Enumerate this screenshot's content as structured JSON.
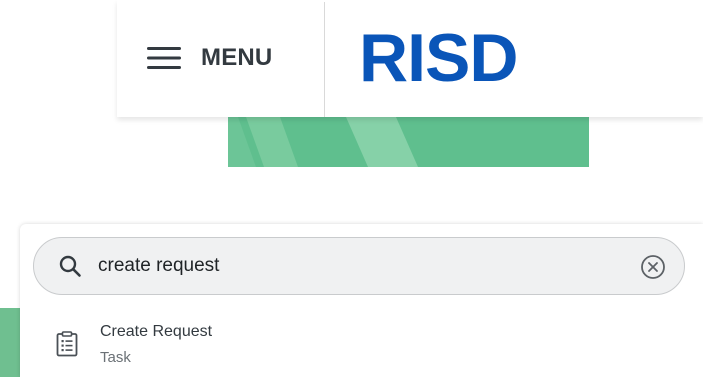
{
  "header": {
    "menu_label": "MENU",
    "logo_text": "RISD",
    "logo_color": "#0a55b8"
  },
  "banner": {
    "color": "#5fbf8e"
  },
  "search": {
    "value": "create request",
    "icon": "search-icon",
    "clear_icon": "clear-icon"
  },
  "results": [
    {
      "title": "Create Request",
      "subtitle": "Task",
      "icon": "task-icon"
    }
  ]
}
